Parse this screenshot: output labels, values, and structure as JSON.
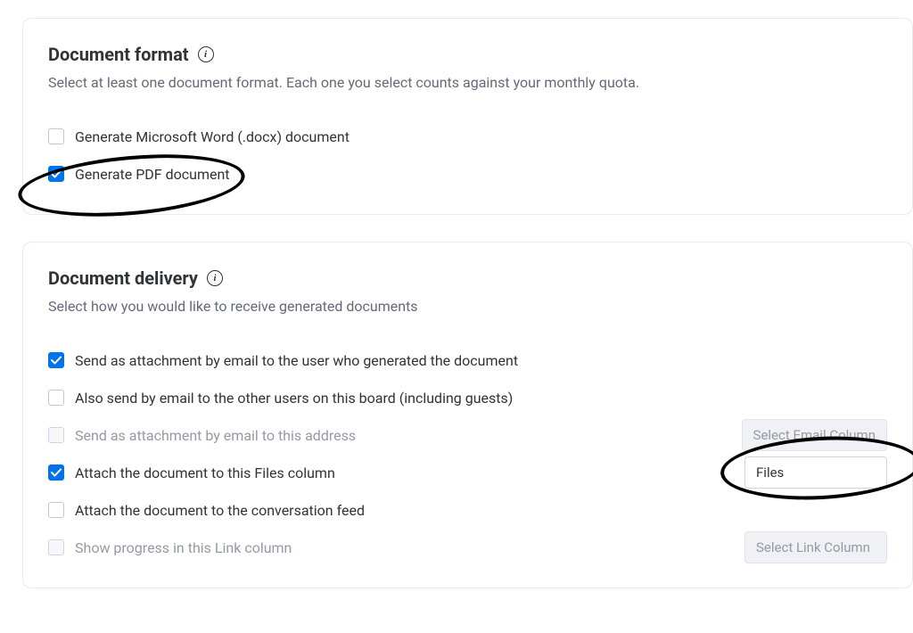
{
  "format_section": {
    "title": "Document format",
    "subtitle": "Select at least one document format. Each one you select counts against your monthly quota.",
    "options": [
      {
        "label": "Generate Microsoft Word (.docx) document",
        "checked": false,
        "disabled": false
      },
      {
        "label": "Generate PDF document",
        "checked": true,
        "disabled": false
      }
    ]
  },
  "delivery_section": {
    "title": "Document delivery",
    "subtitle": "Select how you would like to receive generated documents",
    "options": [
      {
        "label": "Send as attachment by email to the user who generated the document",
        "checked": true,
        "disabled": false,
        "select": null
      },
      {
        "label": "Also send by email to the other users on this board (including guests)",
        "checked": false,
        "disabled": false,
        "select": null
      },
      {
        "label": "Send as attachment by email to this address",
        "checked": false,
        "disabled": true,
        "select": {
          "text": "Select Email Column",
          "disabled": true
        }
      },
      {
        "label": "Attach the document to this Files column",
        "checked": true,
        "disabled": false,
        "select": {
          "text": "Files",
          "disabled": false
        }
      },
      {
        "label": "Attach the document to the conversation feed",
        "checked": false,
        "disabled": false,
        "select": null
      },
      {
        "label": "Show progress in this Link column",
        "checked": false,
        "disabled": true,
        "select": {
          "text": "Select Link Column",
          "disabled": true
        }
      }
    ]
  }
}
